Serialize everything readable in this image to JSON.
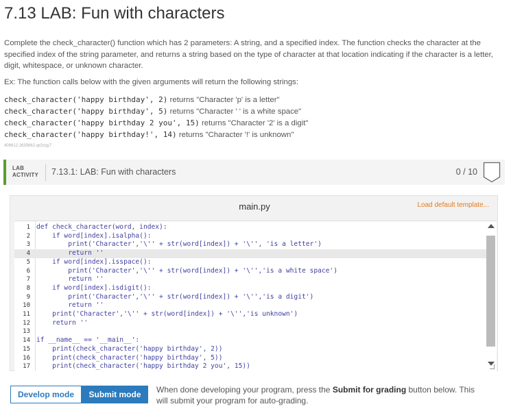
{
  "title": "7.13 LAB: Fun with characters",
  "description": "Complete the check_character() function which has 2 parameters: A string, and a specified index. The function checks the character at the specified index of the string parameter, and returns a string based on the type of character at that location indicating if the character is a letter, digit, whitespace, or unknown character.",
  "example_intro": "Ex: The function calls below with the given arguments will return the following strings:",
  "calls": [
    {
      "code": "check_character('happy birthday', 2)",
      "result": " returns \"Character 'p' is a letter\""
    },
    {
      "code": "check_character('happy birthday', 5)",
      "result": " returns \"Character ' ' is a white space\""
    },
    {
      "code": "check_character('happy birthday 2 you', 15)",
      "result": " returns \"Character '2' is a digit\""
    },
    {
      "code": "check_character('happy birthday!', 14)",
      "result": " returns \"Character '!' is unknown\""
    }
  ],
  "lab_id": "409612.2635662.qx3zqy7",
  "lab": {
    "tag_line1": "LAB",
    "tag_line2": "ACTIVITY",
    "name": "7.13.1: LAB: Fun with characters",
    "score": "0 / 10"
  },
  "editor": {
    "filename": "main.py",
    "load_default": "Load default template...",
    "lines": [
      {
        "num": "1",
        "text": "def check_character(word, index):"
      },
      {
        "num": "2",
        "text": "    if word[index].isalpha():"
      },
      {
        "num": "3",
        "text": "        print('Character','\\'' + str(word[index]) + '\\'', 'is a letter')"
      },
      {
        "num": "4",
        "text": "        return ''"
      },
      {
        "num": "5",
        "text": "    if word[index].isspace():"
      },
      {
        "num": "6",
        "text": "        print('Character','\\'' + str(word[index]) + '\\'','is a white space')"
      },
      {
        "num": "7",
        "text": "        return ''"
      },
      {
        "num": "8",
        "text": "    if word[index].isdigit():"
      },
      {
        "num": "9",
        "text": "        print('Character','\\'' + str(word[index]) + '\\'','is a digit')"
      },
      {
        "num": "10",
        "text": "        return ''"
      },
      {
        "num": "11",
        "text": "    print('Character','\\'' + str(word[index]) + '\\'','is unknown')"
      },
      {
        "num": "12",
        "text": "    return ''"
      },
      {
        "num": "13",
        "text": ""
      },
      {
        "num": "14",
        "text": "if __name__ == '__main__':"
      },
      {
        "num": "15",
        "text": "    print(check_character('happy birthday', 2))"
      },
      {
        "num": "16",
        "text": "    print(check_character('happy birthday', 5))"
      },
      {
        "num": "17",
        "text": "    print(check_character('happy birthday 2 you', 15))"
      }
    ],
    "highlighted_line": 4
  },
  "modes": {
    "develop": "Develop mode",
    "submit": "Submit mode"
  },
  "hint": {
    "before": "When done developing your program, press the ",
    "bold": "Submit for grading",
    "after": " button below. This will submit your program for auto-grading."
  },
  "colors": {
    "accent": "#2b7bbd",
    "lab_border": "#5a9d2e",
    "load_default": "#e37b1c",
    "code_text": "#4040a0"
  }
}
